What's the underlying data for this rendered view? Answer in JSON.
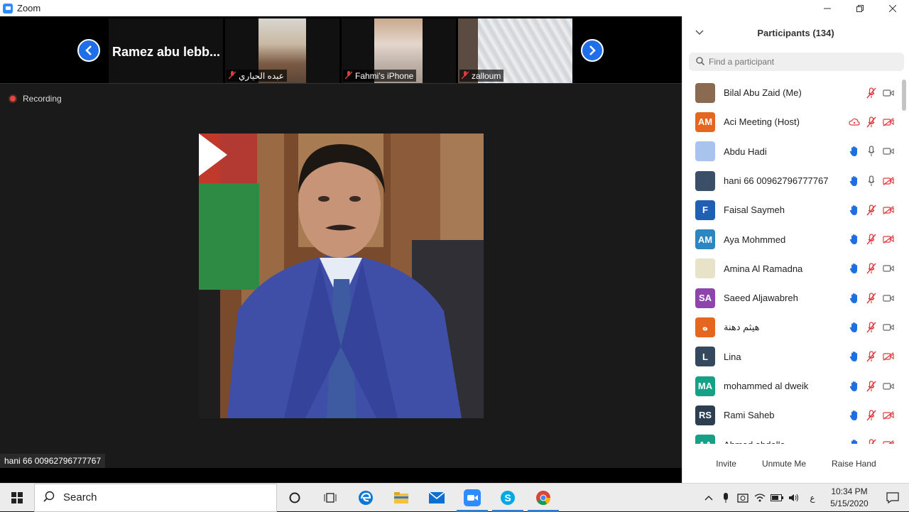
{
  "window": {
    "title": "Zoom",
    "controls": [
      "minimize-icon",
      "maximize-icon",
      "close-icon"
    ]
  },
  "strip": {
    "prev_icon": "chevron-left-icon",
    "next_icon": "chevron-right-icon",
    "tiles": [
      {
        "name": "Ramez abu lebb..."
      },
      {
        "name": "عبده الحياري"
      },
      {
        "name": "Fahmi's iPhone"
      },
      {
        "name": "zalloum"
      }
    ]
  },
  "recording": {
    "label": "Recording"
  },
  "speaker": {
    "name": "hani 66 00962796777767"
  },
  "participants": {
    "title": "Participants (134)",
    "search_placeholder": "Find a participant",
    "list": [
      {
        "name": "Bilal Abu Zaid (Me)",
        "initials": "",
        "avatar_color": "#8a6a50",
        "hand": false,
        "mic": "muted",
        "video": "on",
        "cloud": false
      },
      {
        "name": "Aci Meeting (Host)",
        "initials": "AM",
        "avatar_color": "#e5661e",
        "hand": false,
        "mic": "muted",
        "video": "off",
        "cloud": true
      },
      {
        "name": "Abdu Hadi",
        "initials": "",
        "avatar_color": "#a9c4ec",
        "hand": true,
        "mic": "on",
        "video": "on",
        "cloud": false
      },
      {
        "name": "hani 66 00962796777767",
        "initials": "",
        "avatar_color": "#3b5068",
        "hand": true,
        "mic": "on",
        "video": "off",
        "cloud": false
      },
      {
        "name": "Faisal Saymeh",
        "initials": "F",
        "avatar_color": "#1f5fb4",
        "hand": true,
        "mic": "muted",
        "video": "off",
        "cloud": false
      },
      {
        "name": "Aya Mohmmed",
        "initials": "AM",
        "avatar_color": "#2e86c1",
        "hand": true,
        "mic": "muted",
        "video": "off",
        "cloud": false
      },
      {
        "name": "Amina Al Ramadna",
        "initials": "",
        "avatar_color": "#e8e2c8",
        "hand": true,
        "mic": "muted",
        "video": "on",
        "cloud": false
      },
      {
        "name": "Saeed Aljawabreh",
        "initials": "SA",
        "avatar_color": "#8e44ad",
        "hand": true,
        "mic": "muted",
        "video": "on",
        "cloud": false
      },
      {
        "name": "هيثم دهنة",
        "initials": "ه",
        "avatar_color": "#e5661e",
        "hand": true,
        "mic": "muted",
        "video": "on",
        "cloud": false
      },
      {
        "name": "Lina",
        "initials": "L",
        "avatar_color": "#34495e",
        "hand": true,
        "mic": "muted",
        "video": "off",
        "cloud": false
      },
      {
        "name": "mohammed al dweik",
        "initials": "MA",
        "avatar_color": "#16a085",
        "hand": true,
        "mic": "muted",
        "video": "on",
        "cloud": false
      },
      {
        "name": "Rami Saheb",
        "initials": "RS",
        "avatar_color": "#2c3e50",
        "hand": true,
        "mic": "muted",
        "video": "off",
        "cloud": false
      },
      {
        "name": "Ahmad abdalla",
        "initials": "AA",
        "avatar_color": "#16a085",
        "hand": true,
        "mic": "muted",
        "video": "off",
        "cloud": false
      }
    ],
    "footer": {
      "invite": "Invite",
      "unmute": "Unmute Me",
      "raise": "Raise Hand"
    }
  },
  "taskbar": {
    "search_label": "Search",
    "apps": [
      "cortana-icon",
      "task-view-icon",
      "edge-icon",
      "file-explorer-icon",
      "mail-icon",
      "zoom-icon",
      "skype-icon",
      "chrome-icon"
    ],
    "lang": "ع",
    "time": "10:34 PM",
    "date": "5/15/2020"
  }
}
